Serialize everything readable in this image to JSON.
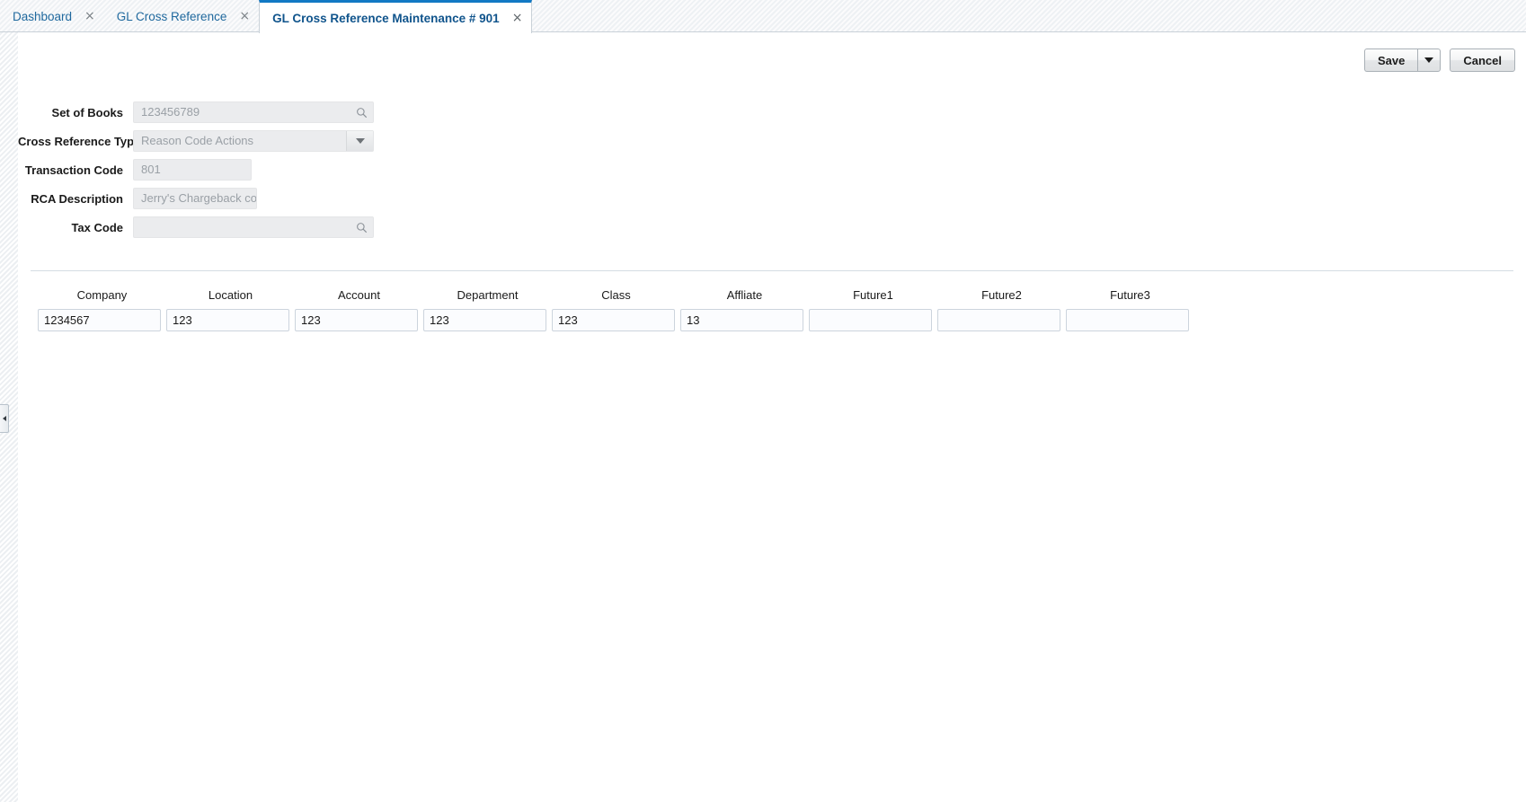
{
  "tabs": [
    {
      "label": "Dashboard",
      "close": "×",
      "active": false
    },
    {
      "label": "GL Cross Reference",
      "close": "×",
      "active": false
    },
    {
      "label": "GL Cross Reference Maintenance # 901",
      "close": "×",
      "active": true
    }
  ],
  "toolbar": {
    "save_label": "Save",
    "save_dropdown_icon": "chevron-down-icon",
    "cancel_label": "Cancel"
  },
  "form": {
    "fields": [
      {
        "label": "Set of Books",
        "value": "123456789",
        "control": "lov",
        "icon": "search-icon",
        "disabled": true
      },
      {
        "label": "Cross Reference Type",
        "value": "Reason Code Actions",
        "control": "dropdown",
        "icon": "chevron-down-icon",
        "disabled": true
      },
      {
        "label": "Transaction Code",
        "value": "801",
        "control": "text",
        "icon": "",
        "disabled": true
      },
      {
        "label": "RCA Description",
        "value": "Jerry's Chargeback cod",
        "control": "text",
        "icon": "",
        "disabled": true
      },
      {
        "label": "Tax Code",
        "value": "",
        "control": "lov",
        "icon": "search-icon",
        "disabled": true
      }
    ]
  },
  "grid": {
    "columns": [
      "Company",
      "Location",
      "Account",
      "Department",
      "Class",
      "Affliate",
      "Future1",
      "Future2",
      "Future3"
    ],
    "rows": [
      [
        "1234567",
        "123",
        "123",
        "123",
        "123",
        "13",
        "",
        "",
        ""
      ]
    ]
  },
  "sidebar": {
    "collapse_handle_icon": "chevron-left-icon"
  },
  "colors": {
    "accent": "#1279c4",
    "tab_link": "#20699e",
    "active_tab_text": "#10548c",
    "field_disabled_bg": "#ebecee",
    "field_disabled_text": "#9aa0a6",
    "grid_input_border": "#ccd4dd",
    "divider": "#d5dce3"
  }
}
